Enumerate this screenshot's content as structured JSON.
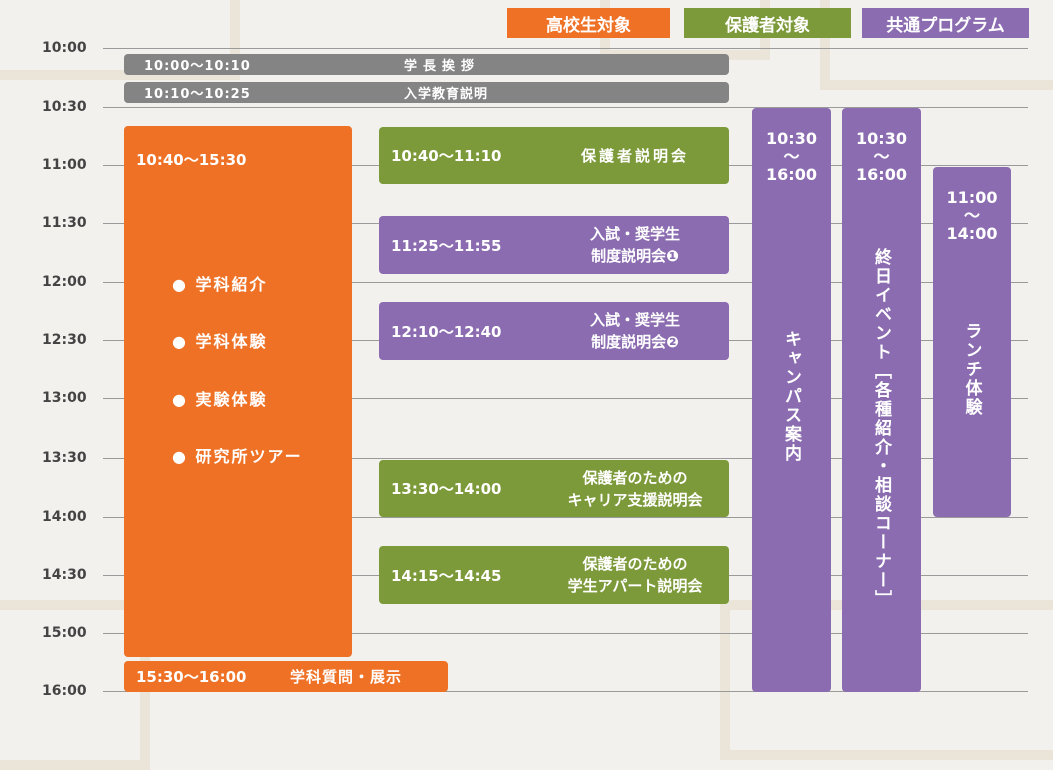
{
  "legend": {
    "high_school": "高校生対象",
    "parents": "保護者対象",
    "common": "共通プログラム"
  },
  "times": [
    "10:00",
    "10:30",
    "11:00",
    "11:30",
    "12:00",
    "12:30",
    "13:00",
    "13:30",
    "14:00",
    "14:30",
    "15:00",
    "16:00"
  ],
  "gray_items": [
    {
      "time": "10:00〜10:10",
      "name": "学長挨拶"
    },
    {
      "time": "10:10〜10:25",
      "name": "入学教育説明"
    }
  ],
  "orange_main": {
    "time": "10:40〜15:30",
    "items": [
      "● 学科紹介",
      "● 学科体験",
      "● 実験体験",
      "● 研究所ツアー"
    ]
  },
  "orange_bottom": {
    "time": "15:30〜16:00",
    "name": "学科質問・展示"
  },
  "sessions": [
    {
      "time": "10:40〜11:10",
      "line1": "保護者説明会",
      "line2": ""
    },
    {
      "time": "11:25〜11:55",
      "line1": "入試・奨学生",
      "line2": "制度説明会❶"
    },
    {
      "time": "12:10〜12:40",
      "line1": "入試・奨学生",
      "line2": "制度説明会❷"
    },
    {
      "time": "13:30〜14:00",
      "line1": "保護者のための",
      "line2": "キャリア支援説明会"
    },
    {
      "time": "14:15〜14:45",
      "line1": "保護者のための",
      "line2": "学生アパート説明会"
    }
  ],
  "columns": [
    {
      "start": "10:30",
      "sep": "〜",
      "end": "16:00",
      "name": "キャンパス案内"
    },
    {
      "start": "10:30",
      "sep": "〜",
      "end": "16:00",
      "name": "終日イベント［各種紹介・相談コーナー］"
    },
    {
      "start": "11:00",
      "sep": "〜",
      "end": "14:00",
      "name": "ランチ体験"
    }
  ]
}
